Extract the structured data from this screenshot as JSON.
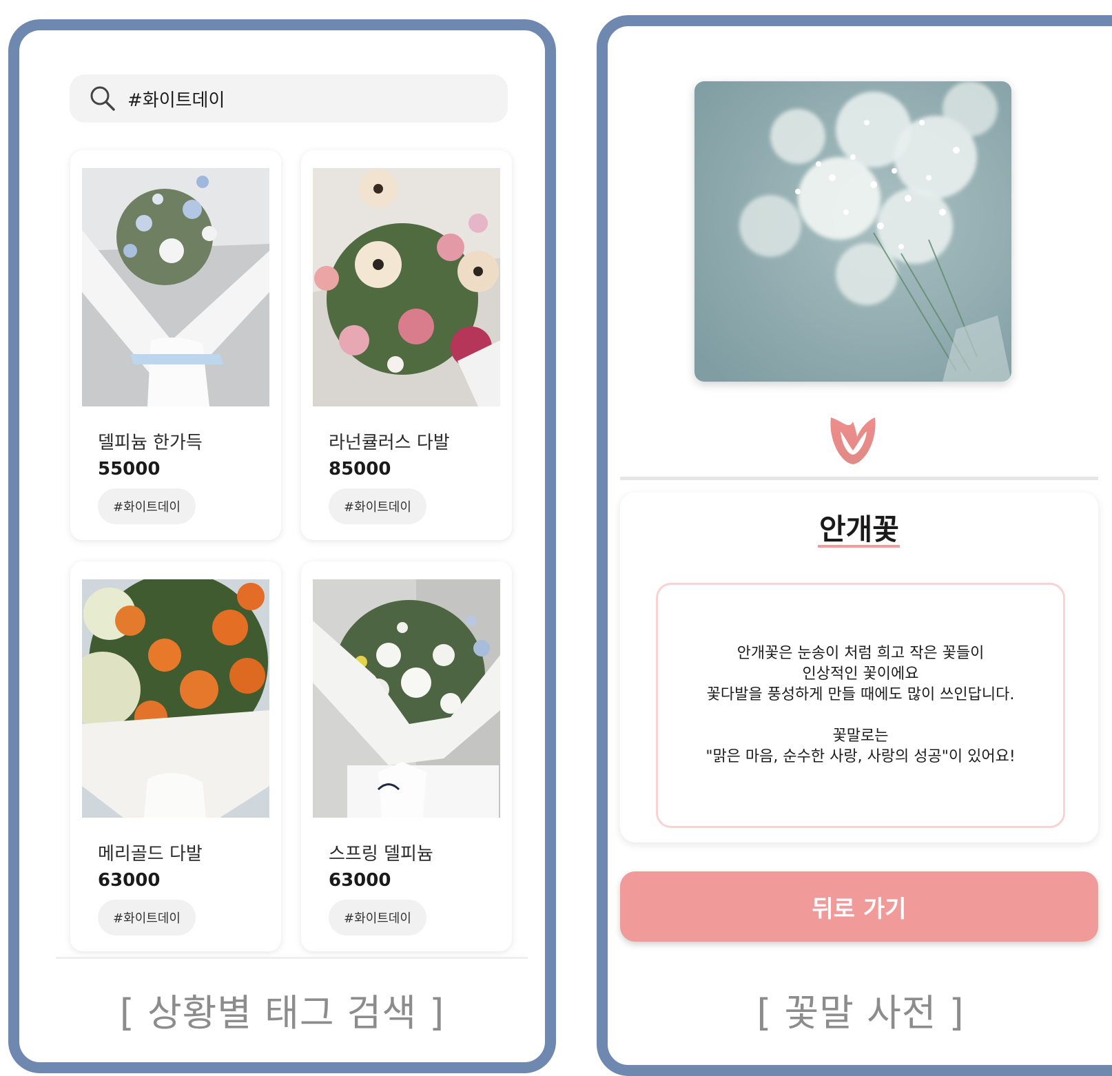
{
  "search_screen": {
    "query": "#화이트데이",
    "products": [
      {
        "name": "델피늄 한가득",
        "price": "55000",
        "tag": "#화이트데이",
        "image": "white-blue-bouquet"
      },
      {
        "name": "라넌큘러스 다발",
        "price": "85000",
        "tag": "#화이트데이",
        "image": "pink-gerbera-bouquet"
      },
      {
        "name": "메리골드 다발",
        "price": "63000",
        "tag": "#화이트데이",
        "image": "orange-marigold-bouquet"
      },
      {
        "name": "스프링 델피늄",
        "price": "63000",
        "tag": "#화이트데이",
        "image": "spring-white-bouquet"
      }
    ],
    "caption": "[ 상황별 태그 검색 ]"
  },
  "dictionary_screen": {
    "photo": "babys-breath-photo",
    "logo": "tulip-logo-icon",
    "flower_name": "안개꽃",
    "meaning_lines": [
      "안개꽃은 눈송이 처럼 희고 작은 꽃들이",
      "인상적인 꽃이에요",
      "꽃다발을 풍성하게 만들 때에도 많이 쓰인답니다."
    ],
    "meaning_lines_2": [
      "꽃말로는",
      "\"맑은 마음, 순수한 사랑, 사랑의 성공\"이 있어요!"
    ],
    "back_button": "뒤로 가기",
    "caption": "[ 꽃말 사전 ]"
  },
  "colors": {
    "frame": "#6e88b0",
    "accent": "#f09a99",
    "underline": "#ee9d9d",
    "box_border": "#f7d3d3"
  }
}
